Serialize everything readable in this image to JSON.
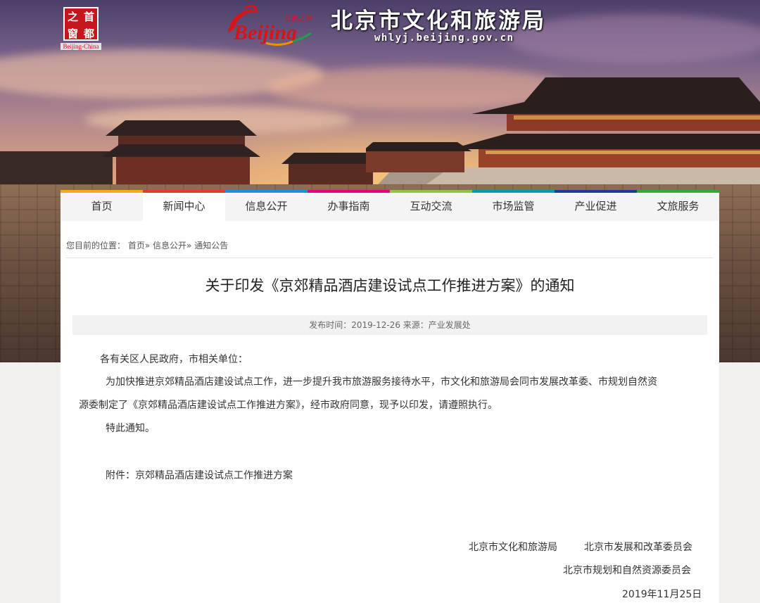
{
  "header": {
    "seal_chars": [
      "之",
      "首",
      "窗",
      "都"
    ],
    "seal_caption": "Beijing-China",
    "logo_script": "Beijing",
    "logo_cn": "北京之旅",
    "site_title": "北京市文化和旅游局",
    "site_domain": "whlyj.beijing.gov.cn"
  },
  "nav": {
    "items": [
      {
        "label": "首页",
        "color": "#f5a623"
      },
      {
        "label": "新闻中心",
        "color": "#e03c31"
      },
      {
        "label": "信息公开",
        "color": "#1f8fd6"
      },
      {
        "label": "办事指南",
        "color": "#e6007e"
      },
      {
        "label": "互动交流",
        "color": "#8cc63f"
      },
      {
        "label": "市场监管",
        "color": "#00a0a8"
      },
      {
        "label": "产业促进",
        "color": "#1d3e8f"
      },
      {
        "label": "文旅服务",
        "color": "#3aa637"
      }
    ],
    "active_index": 1
  },
  "breadcrumb": {
    "prefix": "您目前的位置：",
    "home": "首页",
    "sep": "»",
    "section": "信息公开",
    "current": "通知公告"
  },
  "article": {
    "title": "关于印发《京郊精品酒店建设试点工作推进方案》的通知",
    "meta": "发布时间：2019-12-26 来源：产业发展处",
    "salutation": "各有关区人民政府，市相关单位：",
    "para1_line1": "为加快推进京郊精品酒店建设试点工作，进一步提升我市旅游服务接待水平，市文化和旅游局会同市发展改革委、市规划自然资",
    "para1_line2": "源委制定了《京郊精品酒店建设试点工作推进方案》，经市政府同意，现予以印发，请遵照执行。",
    "closing": "特此通知。",
    "attachment": "附件：京郊精品酒店建设试点工作推进方案",
    "signer1": "北京市文化和旅游局",
    "signer2": "北京市发展和改革委员会",
    "signer3": "北京市规划和自然资源委员会",
    "date": "2019年11月25日"
  }
}
